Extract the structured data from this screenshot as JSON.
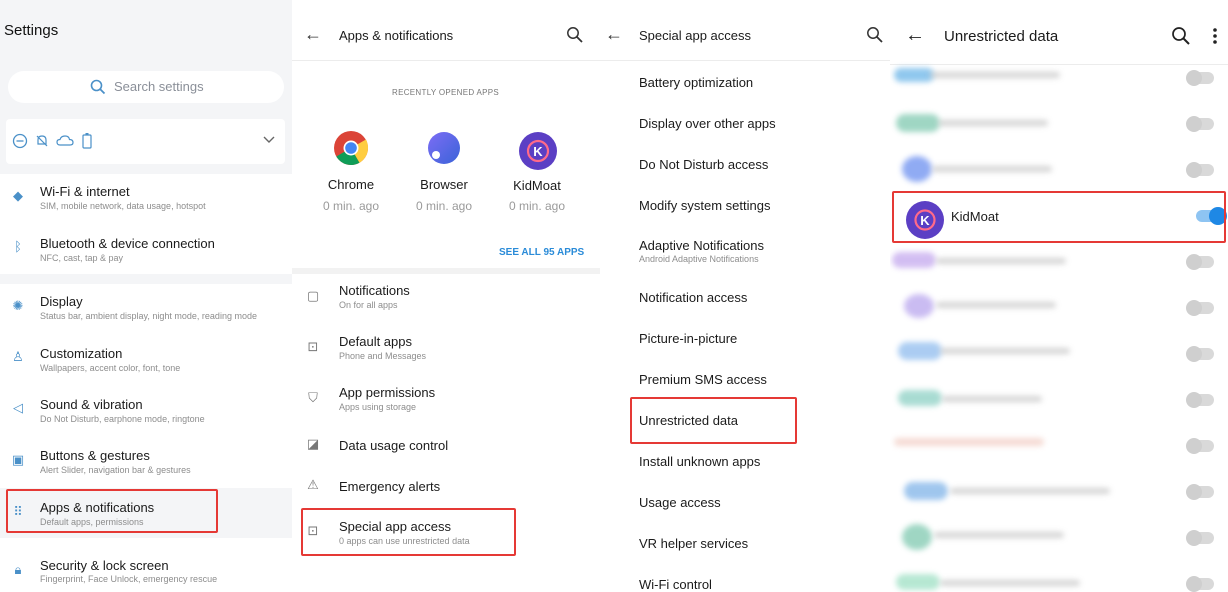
{
  "panel1": {
    "title": "Settings",
    "search_placeholder": "Search settings",
    "items": [
      {
        "title": "Wi-Fi & internet",
        "subtitle": "SIM, mobile network, data usage, hotspot",
        "icon": "wifi-icon"
      },
      {
        "title": "Bluetooth & device connection",
        "subtitle": "NFC, cast, tap & pay",
        "icon": "bluetooth-icon"
      },
      {
        "title": "Display",
        "subtitle": "Status bar, ambient display, night mode, reading mode",
        "icon": "display-icon"
      },
      {
        "title": "Customization",
        "subtitle": "Wallpapers, accent color, font, tone",
        "icon": "shirt-icon"
      },
      {
        "title": "Sound & vibration",
        "subtitle": "Do Not Disturb, earphone mode, ringtone",
        "icon": "speaker-icon"
      },
      {
        "title": "Buttons & gestures",
        "subtitle": "Alert Slider, navigation bar & gestures",
        "icon": "buttons-icon"
      },
      {
        "title": "Apps & notifications",
        "subtitle": "Default apps, permissions",
        "icon": "apps-grid-icon"
      },
      {
        "title": "Security & lock screen",
        "subtitle": "Fingerprint, Face Unlock, emergency rescue",
        "icon": "lock-icon"
      }
    ]
  },
  "panel2": {
    "title": "Apps & notifications",
    "recent_label": "RECENTLY OPENED APPS",
    "apps": [
      {
        "name": "Chrome",
        "time": "0 min. ago"
      },
      {
        "name": "Browser",
        "time": "0 min. ago"
      },
      {
        "name": "KidMoat",
        "time": "0 min. ago"
      }
    ],
    "see_all": "SEE ALL 95 APPS",
    "items": [
      {
        "title": "Notifications",
        "subtitle": "On for all apps"
      },
      {
        "title": "Default apps",
        "subtitle": "Phone and Messages"
      },
      {
        "title": "App permissions",
        "subtitle": "Apps using storage"
      },
      {
        "title": "Data usage control",
        "subtitle": ""
      },
      {
        "title": "Emergency alerts",
        "subtitle": ""
      },
      {
        "title": "Special app access",
        "subtitle": "0 apps can use unrestricted data"
      }
    ]
  },
  "panel3": {
    "title": "Special app access",
    "items": [
      {
        "title": "Battery optimization"
      },
      {
        "title": "Display over other apps"
      },
      {
        "title": "Do Not Disturb access"
      },
      {
        "title": "Modify system settings"
      },
      {
        "title": "Adaptive Notifications",
        "subtitle": "Android Adaptive Notifications"
      },
      {
        "title": "Notification access"
      },
      {
        "title": "Picture-in-picture"
      },
      {
        "title": "Premium SMS access"
      },
      {
        "title": "Unrestricted data"
      },
      {
        "title": "Install unknown apps"
      },
      {
        "title": "Usage access"
      },
      {
        "title": "VR helper services"
      },
      {
        "title": "Wi-Fi control"
      }
    ]
  },
  "panel4": {
    "title": "Unrestricted data",
    "highlighted_app": "KidMoat",
    "highlighted_enabled": true
  },
  "colors": {
    "accent": "#1e88e5",
    "highlight_box": "#e53935",
    "kidmoat_bg": "#5b3fc4"
  }
}
